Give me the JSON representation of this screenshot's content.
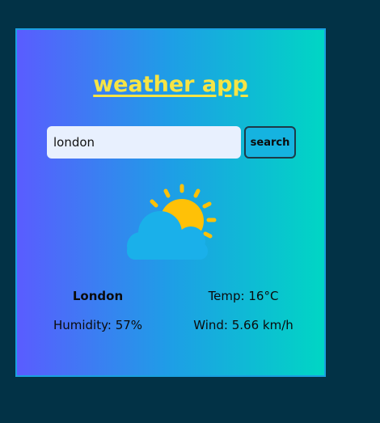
{
  "app": {
    "title": "weather app"
  },
  "search": {
    "value": "london",
    "button_label": "search"
  },
  "weather": {
    "icon": "partly-cloudy-icon",
    "city": "London",
    "temp": "Temp: 16°C",
    "humidity": "Humidity: 57%",
    "wind": "Wind: 5.66 km/h"
  },
  "colors": {
    "page_background": "#023246",
    "gradient_start": "#5a5cff",
    "gradient_end": "#00d6c4",
    "title": "#f6e445",
    "sun": "#ffc107",
    "cloud": "#1ab0ea"
  }
}
